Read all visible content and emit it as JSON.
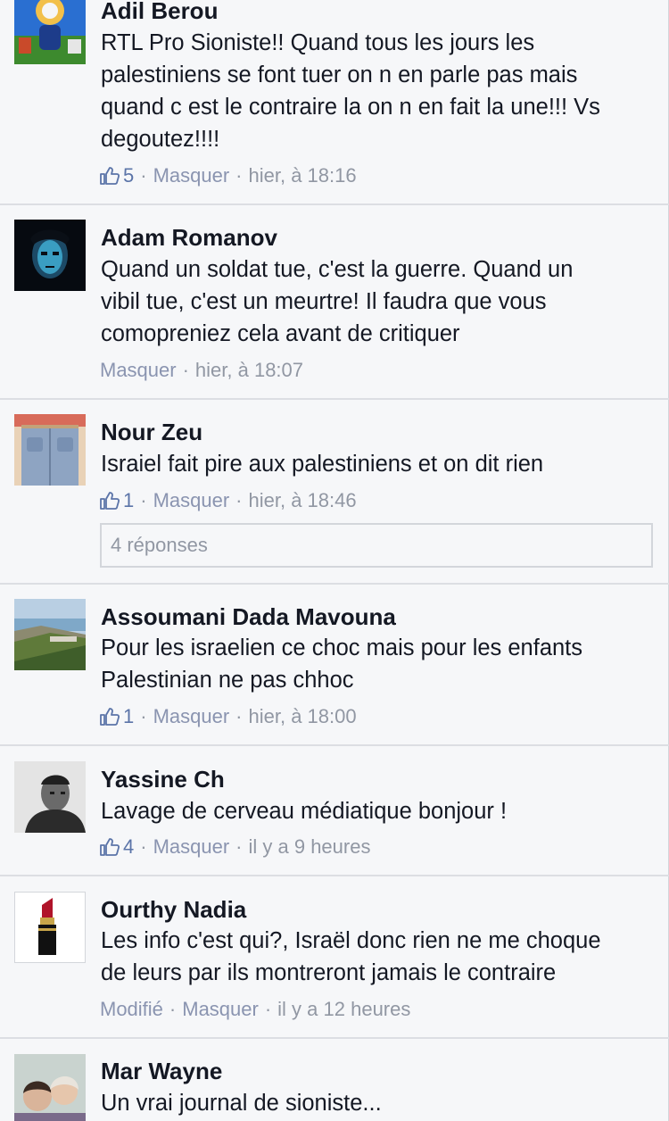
{
  "comments": [
    {
      "author": "Adil Berou",
      "lines": [
        "RTL Pro Sioniste!! Quand tous les jours les",
        "palestiniens se font tuer on n en parle pas mais",
        "quand c est le contraire la on n en fait la une!!! Vs",
        "degoutez!!!!"
      ],
      "likes": "5",
      "hide_label": "Masquer",
      "time": "hier, à 18:16",
      "avatar_icon": "cartoon-avatar-icon"
    },
    {
      "author": "Adam Romanov",
      "lines": [
        "Quand un soldat tue, c'est la guerre. Quand un",
        "vibil tue, c'est un meurtre! Il faudra que vous",
        "comopreniez cela avant de critiquer"
      ],
      "hide_label": "Masquer",
      "time": "hier, à 18:07",
      "avatar_icon": "masked-face-avatar-icon"
    },
    {
      "author": "Nour Zeu",
      "lines": [
        "Israiel fait pire aux palestiniens et on dit rien"
      ],
      "likes": "1",
      "hide_label": "Masquer",
      "time": "hier, à 18:46",
      "replies": "4 réponses",
      "avatar_icon": "jeans-avatar-icon"
    },
    {
      "author": "Assoumani Dada Mavouna",
      "lines": [
        "Pour les israelien ce choc mais pour les enfants",
        "Palestinian ne pas chhoc"
      ],
      "likes": "1",
      "hide_label": "Masquer",
      "time": "hier, à 18:00",
      "avatar_icon": "coast-landscape-avatar-icon"
    },
    {
      "author": "Yassine Ch",
      "lines": [
        "Lavage de cerveau médiatique bonjour !"
      ],
      "likes": "4",
      "hide_label": "Masquer",
      "time": "il y a 9 heures",
      "avatar_icon": "portrait-avatar-icon"
    },
    {
      "author": "Ourthy Nadia",
      "lines": [
        "Les info c'est qui?, Israël donc rien ne me choque",
        "de leurs par ils montreront jamais le contraire"
      ],
      "edited_label": "Modifié",
      "hide_label": "Masquer",
      "time": "il y a 12 heures",
      "avatar_icon": "lipstick-avatar-icon"
    },
    {
      "author": "Mar Wayne",
      "lines": [
        "Un vrai journal de sioniste..."
      ],
      "avatar_icon": "children-avatar-icon"
    }
  ],
  "meta_separator": "·",
  "colors": {
    "background": "#f6f7f9",
    "text": "#141823",
    "meta": "#9197a3",
    "like_blue": "#5b74a8",
    "divider": "#dcdee3"
  }
}
